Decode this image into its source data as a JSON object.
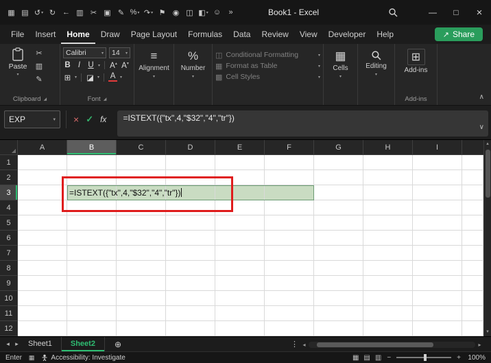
{
  "colors": {
    "excel_green": "#2a9d5c",
    "fill_green": "#c9dcc2",
    "annotation_red": "#df1c1c",
    "selection_green": "#2ebd72"
  },
  "icons": {
    "dropdown": "▾",
    "dialog_launcher": "◢",
    "collapse_ribbon": "∧",
    "expand_formula_bar": "∨",
    "select_all": "◢",
    "scroll_up": "▴",
    "scroll_down": "▾",
    "scroll_left": "◂",
    "scroll_right": "▸",
    "kebab": "⋮",
    "add_sheet": "⊕",
    "zoom_out": "−",
    "zoom_in": "+",
    "caret_up": "▴",
    "caret_down": "▾"
  },
  "titlebar": {
    "title": "Book1 - Excel",
    "qat_icons": [
      {
        "name": "apps-icon",
        "glyph": "▦"
      },
      {
        "name": "save-icon",
        "glyph": "▤"
      },
      {
        "name": "undo-icon",
        "glyph": "↺",
        "dropdown": true
      },
      {
        "name": "redo-icon",
        "glyph": "↻"
      },
      {
        "name": "back-icon",
        "glyph": "←"
      },
      {
        "name": "copy-icon",
        "glyph": "▥"
      },
      {
        "name": "cut-icon",
        "glyph": "✂"
      },
      {
        "name": "paste-qat-icon",
        "glyph": "▣"
      },
      {
        "name": "format-painter-qat-icon",
        "glyph": "✎"
      },
      {
        "name": "percent-style-icon",
        "glyph": "%",
        "dropdown": true
      },
      {
        "name": "repeat-icon",
        "glyph": "↷",
        "dropdown": true
      },
      {
        "name": "flag-icon",
        "glyph": "⚑"
      },
      {
        "name": "camera-icon",
        "glyph": "◉"
      },
      {
        "name": "insert-table-icon",
        "glyph": "◫"
      },
      {
        "name": "insert-chart-icon",
        "glyph": "◧",
        "dropdown": true
      },
      {
        "name": "add-user-icon",
        "glyph": "☺"
      },
      {
        "name": "more-commands-icon",
        "glyph": "»"
      }
    ],
    "window": {
      "minimize": "—",
      "maximize": "□",
      "close": "×"
    }
  },
  "tabs": {
    "items": [
      "File",
      "Insert",
      "Home",
      "Draw",
      "Page Layout",
      "Formulas",
      "Data",
      "Review",
      "View",
      "Developer",
      "Help"
    ],
    "active": "Home",
    "share": "Share",
    "share_arrow": "↗"
  },
  "ribbon": {
    "paste_label": "Paste",
    "clipboard_label": "Clipboard",
    "mini_clipboard": [
      {
        "name": "cut-button",
        "glyph": "✂"
      },
      {
        "name": "copy-button",
        "glyph": "▥"
      },
      {
        "name": "format-painter-button",
        "glyph": "✎"
      }
    ],
    "font_name": "Calibri",
    "font_size": "14",
    "font_label": "Font",
    "font_controls": {
      "bold": "B",
      "italic": "I",
      "underline": "U",
      "increase_font": "A",
      "decrease_font": "A",
      "borders": "⊞",
      "fill_color": "◪",
      "font_color": "A"
    },
    "alignment_label": "Alignment",
    "alignment_icon": "≡",
    "number_label": "Number",
    "number_icon": "%",
    "styles_items": [
      {
        "name": "conditional-formatting",
        "icon": "◫",
        "label": "Conditional Formatting"
      },
      {
        "name": "format-as-table",
        "icon": "▦",
        "label": "Format as Table"
      },
      {
        "name": "cell-styles",
        "icon": "▩",
        "label": "Cell Styles"
      }
    ],
    "cells_label": "Cells",
    "cells_icon": "▦",
    "editing_label": "Editing",
    "addins_label": "Add-ins",
    "addins_icon": "⊞",
    "addins_group_label": "Add-ins"
  },
  "formula_bar": {
    "name_box": "EXP",
    "cancel": "×",
    "enter": "✓",
    "fx": "fx",
    "formula": "=ISTEXT({\"tx\",4,\"$32\",\"4\",\"tr\"})"
  },
  "grid": {
    "columns": [
      "A",
      "B",
      "C",
      "D",
      "E",
      "F",
      "G",
      "H",
      "I"
    ],
    "active_column": "B",
    "rows": [
      "1",
      "2",
      "3",
      "4",
      "5",
      "6",
      "7",
      "8",
      "9",
      "10",
      "11",
      "12"
    ],
    "active_row": "3",
    "fill_range": "B3:F3",
    "edit_cell": {
      "ref": "B3",
      "text": "=ISTEXT({\"tx\",4,\"$32\",\"4\",\"tr\"})"
    }
  },
  "sheet_bar": {
    "tabs": [
      {
        "label": "Sheet1",
        "active": false
      },
      {
        "label": "Sheet2",
        "active": true
      }
    ]
  },
  "status_bar": {
    "mode": "Enter",
    "macro_glyph": "▦",
    "accessibility": "Accessibility: Investigate",
    "views": [
      {
        "name": "normal-view-icon",
        "glyph": "▦"
      },
      {
        "name": "page-layout-view-icon",
        "glyph": "▤"
      },
      {
        "name": "page-break-preview-icon",
        "glyph": "▥"
      }
    ],
    "zoom": "100%"
  }
}
